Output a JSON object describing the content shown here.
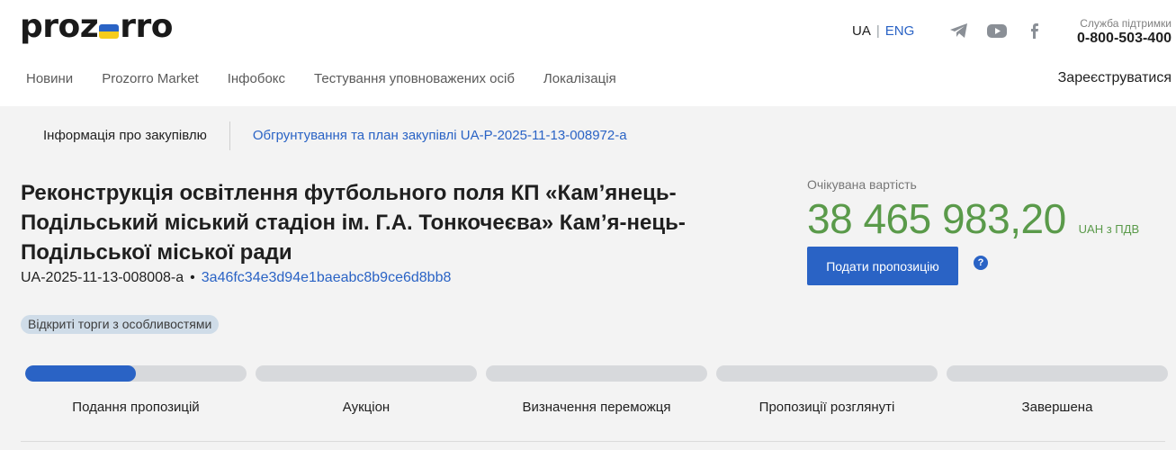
{
  "header": {
    "logo": {
      "pre": "proz",
      "post": "rro"
    },
    "lang": {
      "ua": "UA",
      "separator": "|",
      "eng": "ENG"
    },
    "social": [
      "telegram-icon",
      "youtube-icon",
      "facebook-icon"
    ],
    "support": {
      "label": "Служба підтримки",
      "phone": "0-800-503-400"
    },
    "nav": [
      "Новини",
      "Prozorro Market",
      "Інфобокс",
      "Тестування уповноважених осіб",
      "Локалізація"
    ],
    "register": "Зареєструватися"
  },
  "tabs": {
    "info": "Інформація про закупівлю",
    "plan": "Обгрунтування та план закупівлі UA-P-2025-11-13-008972-a"
  },
  "tender": {
    "title": "Реконструкція освітлення футбольного поля КП «Кам’янець-Подільський міський стадіон ім. Г.А. Тонкочеєва» Кам’я-нець-Подільської міської ради",
    "id": "UA-2025-11-13-008008-a",
    "bullet": "•",
    "hash": "3a46fc34e3d94e1baeabc8b9ce6d8bb8",
    "procedure": "Відкриті торги з особливостями"
  },
  "value": {
    "label": "Очікувана вартість",
    "amount": "38 465 983,20",
    "currency": "UAH з ПДВ",
    "submit": "Подати пропозицію",
    "help": "?"
  },
  "stages": [
    {
      "label": "Подання пропозицій",
      "progress": 0.5
    },
    {
      "label": "Аукціон",
      "progress": 0
    },
    {
      "label": "Визначення переможця",
      "progress": 0
    },
    {
      "label": "Пропозиції розглянуті",
      "progress": 0
    },
    {
      "label": "Завершена",
      "progress": 0
    }
  ],
  "colors": {
    "accent": "#2a63c5",
    "value": "#5a9a4a",
    "badge": "#cfdce8",
    "background": "#f3f3f3"
  }
}
